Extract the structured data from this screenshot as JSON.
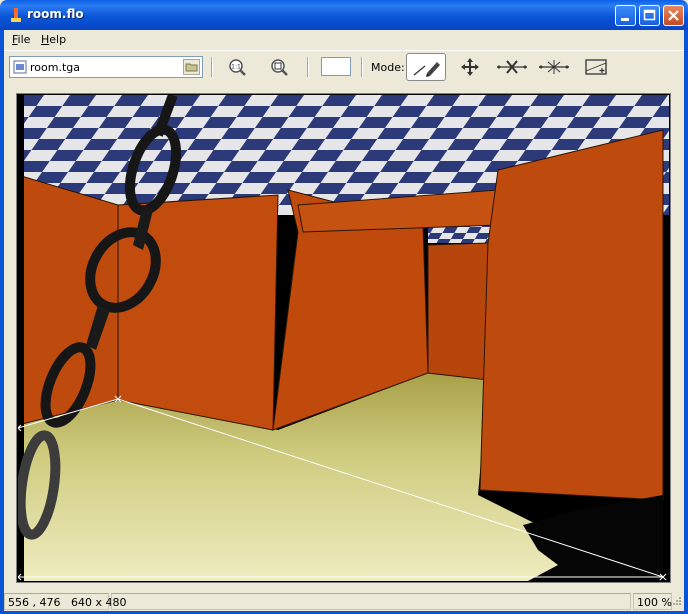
{
  "window": {
    "title": "room.flo"
  },
  "menu": [
    {
      "label": "File"
    },
    {
      "label": "Help"
    }
  ],
  "toolbar": {
    "file_name": "room.tga",
    "zoom_value": "",
    "mode_label": "Mode:",
    "tools": [
      {
        "name": "zoom-actual-size",
        "icon": "zoom-1to1-icon"
      },
      {
        "name": "zoom-fit",
        "icon": "zoom-fit-icon"
      }
    ],
    "modes": [
      {
        "name": "draw-line",
        "icon": "pen-line-icon",
        "active": true
      },
      {
        "name": "move",
        "icon": "move-arrows-icon",
        "active": false
      },
      {
        "name": "line-edit",
        "icon": "line-cross-icon",
        "active": false
      },
      {
        "name": "point-edit",
        "icon": "line-star-icon",
        "active": false
      },
      {
        "name": "region",
        "icon": "rect-region-icon",
        "active": false
      }
    ]
  },
  "status": {
    "coords": "556 , 476",
    "dimensions": "640 x 480",
    "zoom": "100 %"
  },
  "colors": {
    "title_bar": "#0a5fe6",
    "wall_orange": "#c04a0c",
    "floor_yellow": "#d6d48a",
    "checker_blue": "#2c3a7a"
  }
}
